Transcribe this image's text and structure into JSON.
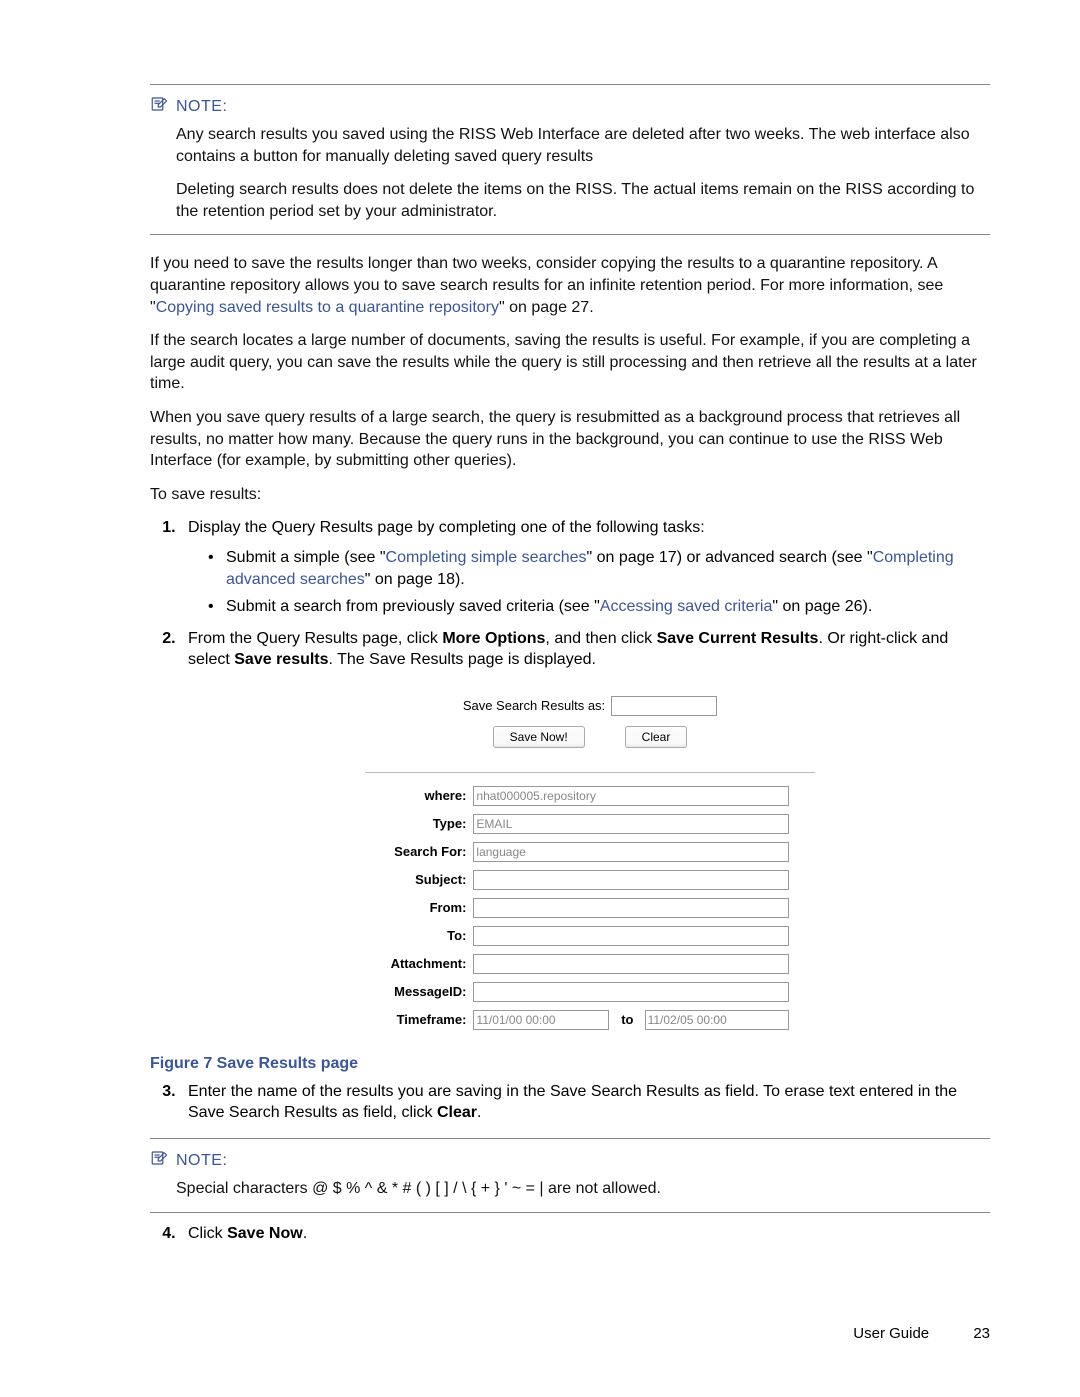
{
  "note1": {
    "title": "NOTE:",
    "para1": "Any search results you saved using the RISS Web Interface are deleted after two weeks. The web interface also contains a button for manually deleting saved query results",
    "para2": "Deleting search results does not delete the items on the RISS. The actual items remain on the RISS according to the retention period set by your administrator."
  },
  "body": {
    "p1a": "If you need to save the results longer than two weeks, consider copying the results to a quarantine repository. A quarantine repository allows you to save search results for an infinite retention period. For more information, see \"",
    "p1link": "Copying saved results to a quarantine repository",
    "p1b": "\" on page 27.",
    "p2": "If the search locates a large number of documents, saving the results is useful. For example, if you are completing a large audit query, you can save the results while the query is still processing and then retrieve all the results at a later time.",
    "p3": "When you save query results of a large search, the query is resubmitted as a background process that retrieves all results, no matter how many. Because the query runs in the background, you can continue to use the RISS Web Interface (for example, by submitting other queries).",
    "p4": "To save results:"
  },
  "steps": {
    "s1": "Display the Query Results page by completing one of the following tasks:",
    "s1b1a": "Submit a simple (see \"",
    "s1b1link1": "Completing simple searches",
    "s1b1b": "\" on page 17) or advanced search (see \"",
    "s1b1link2": "Completing advanced searches",
    "s1b1c": "\" on page 18).",
    "s1b2a": "Submit a search from previously saved criteria (see \"",
    "s1b2link": "Accessing saved criteria",
    "s1b2b": "\" on page 26).",
    "s2a": "From the Query Results page, click ",
    "s2bold1": "More Options",
    "s2b": ", and then click ",
    "s2bold2": "Save Current Results",
    "s2c": ". Or right-click and select ",
    "s2bold3": "Save results",
    "s2d": ". The Save Results page is displayed.",
    "s3a": "Enter the name of the results you are saving in the Save Search Results as field. To erase text entered in the Save Search Results as field, click ",
    "s3bold": "Clear",
    "s3b": ".",
    "s4a": "Click ",
    "s4bold": "Save Now",
    "s4b": "."
  },
  "figure": {
    "saveLabel": "Save Search Results as:",
    "btnSave": "Save Now!",
    "btnClear": "Clear",
    "fields": {
      "where": "where:",
      "whereVal": "nhat000005.repository",
      "type": "Type:",
      "typeVal": "EMAIL",
      "searchFor": "Search For:",
      "searchForVal": "language",
      "subject": "Subject:",
      "from": "From:",
      "to": "To:",
      "attachment": "Attachment:",
      "messageId": "MessageID:",
      "timeframe": "Timeframe:",
      "tfFrom": "11/01/00 00:00",
      "tfToLabel": "to",
      "tfTo": "11/02/05 00:00"
    },
    "caption": "Figure 7 Save Results page"
  },
  "note2": {
    "title": "NOTE:",
    "text": "Special characters @ $ % ^ & * # ( ) [ ] / \\ { + } ' ~ = | are not allowed."
  },
  "footer": {
    "label": "User Guide",
    "page": "23"
  }
}
